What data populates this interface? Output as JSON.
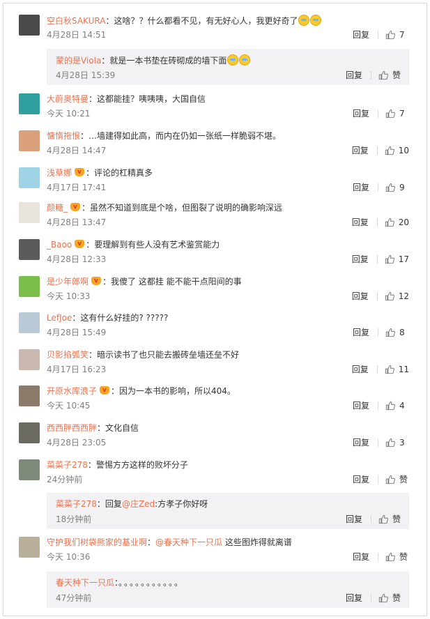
{
  "comments": [
    {
      "name": "空白秋SAKURA",
      "vip": false,
      "text": "这啥？？什么都看不见，有无好心人，我更好奇了",
      "emoji": "😭😭",
      "time": "4月28日 14:51",
      "reply": "回复",
      "likes": "7",
      "avatar_color": "#4a4a4a"
    },
    {
      "name": "大蔚奥特曼",
      "vip": false,
      "text": "这都能挂？咦咦咦，大国自信",
      "emoji": "",
      "time": "今天 10:21",
      "reply": "回复",
      "likes": "7",
      "avatar_color": "#2f9e9e"
    },
    {
      "name": "慵惰拖恨",
      "vip": false,
      "text": "…墙建得如此高，而内在仍如一张纸一样脆弱不堪。",
      "emoji": "",
      "time": "4月28日 14:47",
      "reply": "回复",
      "likes": "10",
      "avatar_color": "#d9a07a"
    },
    {
      "name": "浅草娜",
      "vip": true,
      "text": "评论的杠精真多",
      "emoji": "",
      "time": "4月17日 17:41",
      "reply": "回复",
      "likes": "9",
      "avatar_color": "#9fd3e6"
    },
    {
      "name": "颜糖_",
      "vip": true,
      "text": "虽然不知道到底是个啥，但图裂了说明的确影响深远",
      "emoji": "",
      "time": "4月28日 13:47",
      "reply": "回复",
      "likes": "20",
      "avatar_color": "#e8e4dc"
    },
    {
      "name": "_Baoo",
      "vip": true,
      "text": "要理解到有些人没有艺术鉴赏能力",
      "emoji": "",
      "time": "4月28日 12:33",
      "reply": "回复",
      "likes": "17",
      "avatar_color": "#5a5a5a"
    },
    {
      "name": "是少年郎啊",
      "vip": true,
      "text": "我傻了 这都挂 能不能干点阳间的事",
      "emoji": "",
      "time": "今天 10:33",
      "reply": "回复",
      "likes": "12",
      "avatar_color": "#7bbf4a"
    },
    {
      "name": "LefJoe",
      "vip": false,
      "text": "这有什么好挂的? ?????",
      "emoji": "",
      "time": "4月28日 15:49",
      "reply": "回复",
      "likes": "8",
      "avatar_color": "#b9c9d6"
    },
    {
      "name": "贝影掐弧笑",
      "vip": false,
      "text": "暗示读书了也只能去搬砖垒墙还垒不好",
      "emoji": "",
      "time": "4月17日 16:23",
      "reply": "回复",
      "likes": "11",
      "avatar_color": "#c9b8b0"
    },
    {
      "name": "开原水库浪子",
      "vip": true,
      "text": "因为一本书的影响，所以404。",
      "emoji": "",
      "time": "今天 10:45",
      "reply": "回复",
      "likes": "4",
      "avatar_color": "#8a7a6a"
    },
    {
      "name": "西西胖西西胖",
      "vip": false,
      "text": "文化自信",
      "emoji": "",
      "time": "4月28日 23:05",
      "reply": "回复",
      "likes": "3",
      "avatar_color": "#6a6a60"
    },
    {
      "name": "菜菜子278",
      "vip": false,
      "text": "警惕方方这样的败坏分子",
      "emoji": "",
      "time": "24分钟前",
      "reply": "回复",
      "likes": "赞",
      "avatar_color": "#7d8a7a"
    },
    {
      "name": "守护我们树袋熊家的基业啊",
      "vip": false,
      "mention": "@春天种下一只瓜",
      "text": "这些图炸得就离谱",
      "emoji": "",
      "time": "今天 10:36",
      "reply": "回复",
      "likes": "赞",
      "avatar_color": "#b8b09a"
    }
  ],
  "replies": [
    {
      "name": "蒙的是Viola",
      "text": "就是一本书垫在砖砌成的墙下面",
      "emoji": "😂😂",
      "time": "4月28日 15:39",
      "reply": "回复",
      "likes": "赞"
    },
    {
      "name": "菜菜子278",
      "prefix": "回复",
      "mention": "@庄Zed",
      "text": "方孝子你好呀",
      "time": "18分钟前",
      "reply": "回复",
      "likes": "赞"
    },
    {
      "name": "春天种下一只瓜",
      "text": "。。。。。。。。。。。",
      "time": "47分钟前",
      "reply": "回复",
      "likes": "赞"
    }
  ]
}
